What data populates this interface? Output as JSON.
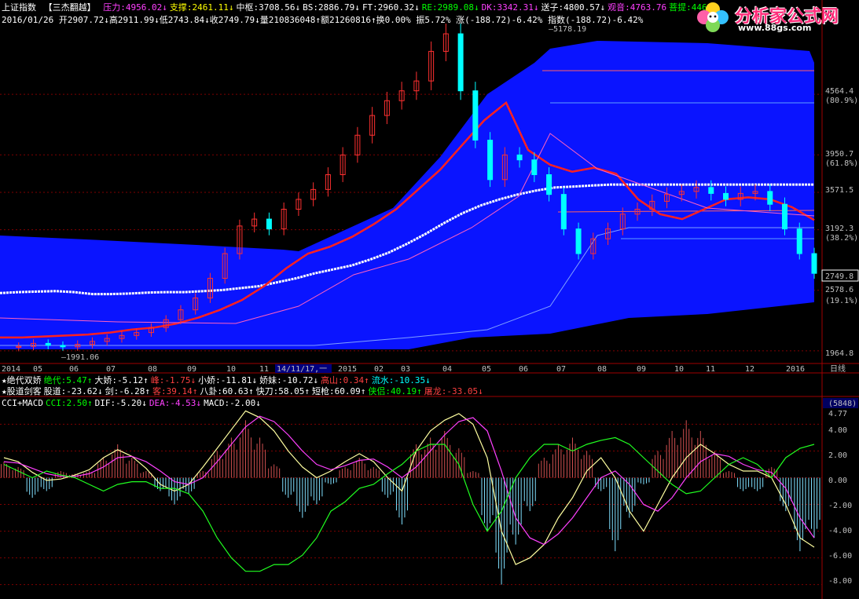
{
  "header": {
    "index_name": "上证指数",
    "formula_name": "【三杰翻越】",
    "indicators_row1": [
      {
        "label": "压力:4956.02↓",
        "color": "#ff40ff"
      },
      {
        "label": "支撑:2461.11↓",
        "color": "#ffff00"
      },
      {
        "label": "中枢:3708.56↓",
        "color": "#ffffff"
      },
      {
        "label": "BS:2886.79↓",
        "color": "#ffffff"
      },
      {
        "label": "FT:2960.32↓",
        "color": "#ffffff"
      },
      {
        "label": "RE:2989.08↓",
        "color": "#00ff00"
      },
      {
        "label": "DK:3342.31↓",
        "color": "#ff40ff"
      },
      {
        "label": "送子:4800.57↓",
        "color": "#ffffff"
      },
      {
        "label": "观音:4763.76",
        "color": "#ff40ff"
      },
      {
        "label": "菩提:4465",
        "color": "#00ff00"
      }
    ],
    "quote_row": "2016/01/26 开2907.72↓高2911.99↓低2743.84↓收2749.79↓量210836048↑额21260816↑换0.00% 振5.72% 涨(-188.72)-6.42% 指数(-188.72)-6.42%",
    "row3": [
      {
        "label": "★绝代双娇",
        "color": "#ffffff"
      },
      {
        "label": "绝代:5.47↑",
        "color": "#00ff00"
      },
      {
        "label": "大娇:-5.12↑",
        "color": "#ffffff"
      },
      {
        "label": "峰:-1.75↓",
        "color": "#ff4040"
      },
      {
        "label": "小娇:-11.81↓",
        "color": "#ffffff"
      },
      {
        "label": "娇妹:-10.72↓",
        "color": "#ffffff"
      },
      {
        "label": "高山:0.34↑",
        "color": "#ff4040"
      },
      {
        "label": "流水:-10.35↓",
        "color": "#00ffff"
      }
    ],
    "row4": [
      {
        "label": "★股道剑客",
        "color": "#ffffff"
      },
      {
        "label": "股道:-23.62↓",
        "color": "#ffffff"
      },
      {
        "label": "剑:-6.28↑",
        "color": "#ffffff"
      },
      {
        "label": "客:39.14↑",
        "color": "#ff4040"
      },
      {
        "label": "八卦:60.63↑",
        "color": "#ffffff"
      },
      {
        "label": "快刀:58.05↑",
        "color": "#ffffff"
      },
      {
        "label": "短枪:60.09↑",
        "color": "#ffffff"
      },
      {
        "label": "侠侣:40.19↑",
        "color": "#00ff00"
      },
      {
        "label": "屠龙:-33.05↓",
        "color": "#ff4040"
      }
    ],
    "row5": [
      {
        "label": "CCI+MACD",
        "color": "#ffffff"
      },
      {
        "label": "CCI:2.50↑",
        "color": "#00ff00"
      },
      {
        "label": "DIF:-5.20↓",
        "color": "#ffffff"
      },
      {
        "label": "DEA:-4.53↓",
        "color": "#ff40ff"
      },
      {
        "label": "MACD:-2.00↓",
        "color": "#ffffff"
      }
    ]
  },
  "watermark": {
    "title": "分析家公式网",
    "url": "www.88gs.com"
  },
  "colors": {
    "band": "#0a14ff",
    "up": "#ff3030",
    "down": "#00ffff",
    "ma_red": "#ff2020",
    "ma_white": "#ffffff",
    "grid": "#800000"
  },
  "chart_data": [
    {
      "type": "candlestick",
      "title": "上证指数",
      "y_ticks": [
        "4564.4",
        "(80.9%)",
        "3950.7",
        "(61.8%)",
        "3571.5",
        "3192.3",
        "(38.2%)",
        "2578.6",
        "(19.1%)",
        "1964.8"
      ],
      "y_tick_values": [
        4564.4,
        null,
        3950.7,
        null,
        3571.5,
        3192.3,
        null,
        2578.6,
        null,
        1964.8
      ],
      "last_price": "2749.8",
      "annotations": [
        "5178.19",
        "1991.06"
      ],
      "x_ticks": [
        "2014",
        "05",
        "06",
        "07",
        "08",
        "09",
        "10",
        "11",
        "14/11/17,一",
        "2015",
        "02",
        "03",
        "04",
        "05",
        "06",
        "07",
        "08",
        "09",
        "10",
        "11",
        "12",
        "2016"
      ],
      "period": "日线",
      "price_series": [
        2000,
        2010,
        2040,
        2020,
        2005,
        2030,
        2060,
        2090,
        2120,
        2150,
        2200,
        2280,
        2380,
        2500,
        2700,
        2950,
        3230,
        3300,
        3200,
        3400,
        3500,
        3600,
        3750,
        3950,
        4150,
        4350,
        4500,
        4600,
        4700,
        5000,
        5178,
        4600,
        4100,
        3700,
        3950,
        3900,
        3750,
        3550,
        3200,
        2950,
        3100,
        3200,
        3350,
        3400,
        3480,
        3550,
        3580,
        3620,
        3560,
        3500,
        3560,
        3580,
        3450,
        3200,
        2950,
        2750
      ],
      "white_ma": [
        2550,
        2560,
        2565,
        2570,
        2560,
        2540,
        2540,
        2545,
        2555,
        2560,
        2560,
        2570,
        2580,
        2600,
        2620,
        2660,
        2700,
        2750,
        2790,
        2830,
        2890,
        2960,
        3050,
        3150,
        3260,
        3360,
        3440,
        3500,
        3550,
        3590,
        3620,
        3630,
        3640,
        3650,
        3650,
        3650,
        3650,
        3650,
        3650,
        3650,
        3650,
        3650,
        3650,
        3650,
        3650
      ],
      "red_ma": [
        2100,
        2100,
        2110,
        2120,
        2130,
        2150,
        2180,
        2200,
        2240,
        2300,
        2380,
        2480,
        2620,
        2800,
        2950,
        3020,
        3120,
        3250,
        3400,
        3600,
        3800,
        4050,
        4300,
        4480,
        4000,
        3850,
        3780,
        3820,
        3760,
        3500,
        3350,
        3300,
        3400,
        3500,
        3520,
        3500,
        3420,
        3290
      ]
    },
    {
      "type": "bar",
      "title": "CCI+MACD",
      "ylim": [
        -8,
        4.77
      ],
      "y_ticks": [
        "(5848)",
        "4.77",
        "4.00",
        "2.00",
        "0.00",
        "-2.00",
        "-4.00",
        "-6.00",
        "-8.00"
      ],
      "y_tick_values": [
        null,
        4.77,
        4,
        2,
        0,
        -2,
        -4,
        -6,
        -8
      ],
      "series": [
        {
          "name": "MACD",
          "values": [
            1.2,
            0.8,
            -1.5,
            -1.0,
            0.5,
            0.3,
            0.5,
            1.5,
            2.5,
            1.5,
            0.5,
            -1.0,
            -2.0,
            -1.2,
            0.5,
            2.0,
            3.0,
            4.3,
            3.0,
            1.0,
            -1.5,
            -3.0,
            -2.0,
            -0.5,
            0.8,
            1.5,
            0.8,
            -1.5,
            -3.5,
            2.5,
            3.0,
            3.5,
            2.2,
            0.5,
            -4.0,
            -8.0,
            -5.0,
            -2.5,
            1.5,
            2.5,
            3.0,
            2.0,
            -1.0,
            -5.5,
            -3.0,
            -0.5,
            2.0,
            3.5,
            4.3,
            3.5,
            2.0,
            0.5,
            -1.0,
            -1.0,
            0.8,
            -2.5,
            -5.5,
            -4.5
          ]
        },
        {
          "name": "DIF",
          "values": [
            1.5,
            1.2,
            0.4,
            -0.2,
            -0.1,
            0.2,
            0.6,
            1.5,
            2.1,
            1.6,
            0.7,
            -0.5,
            -1.0,
            -0.5,
            0.8,
            2.2,
            3.6,
            5.0,
            4.5,
            3.5,
            2.0,
            0.8,
            0.0,
            0.5,
            1.2,
            1.8,
            1.2,
            0.0,
            -1.0,
            2.0,
            3.5,
            4.3,
            4.8,
            4.0,
            1.5,
            -4.0,
            -6.5,
            -6.0,
            -5.0,
            -3.0,
            -1.5,
            0.5,
            1.5,
            0.0,
            -2.5,
            -4.0,
            -2.0,
            0.0,
            1.5,
            2.5,
            1.8,
            1.0,
            0.5,
            0.5,
            0.0,
            -2.0,
            -4.5,
            -5.2
          ]
        },
        {
          "name": "DEA",
          "values": [
            1.2,
            1.1,
            0.7,
            0.3,
            0.1,
            0.1,
            0.3,
            0.8,
            1.5,
            1.6,
            1.2,
            0.5,
            -0.3,
            -0.5,
            0.0,
            1.2,
            2.5,
            3.8,
            4.6,
            4.2,
            3.2,
            2.0,
            1.0,
            0.6,
            0.9,
            1.3,
            1.4,
            0.8,
            0.0,
            0.8,
            2.0,
            3.2,
            4.2,
            4.5,
            3.5,
            0.5,
            -3.0,
            -4.5,
            -5.0,
            -4.2,
            -3.0,
            -1.5,
            0.0,
            0.5,
            -0.5,
            -2.0,
            -2.5,
            -1.5,
            0.0,
            1.2,
            1.8,
            1.6,
            1.0,
            0.6,
            0.4,
            -0.8,
            -3.0,
            -4.5
          ]
        },
        {
          "name": "CCI",
          "values": [
            1.0,
            0.5,
            0.0,
            0.5,
            0.2,
            0.0,
            -0.5,
            -1.0,
            -0.5,
            -0.3,
            -0.3,
            -0.8,
            -0.8,
            -1.2,
            -2.5,
            -4.5,
            -6.0,
            -7.0,
            -7.0,
            -6.5,
            -6.5,
            -5.8,
            -4.5,
            -2.5,
            -1.8,
            -0.8,
            -0.5,
            0.3,
            1.0,
            2.0,
            2.5,
            2.5,
            1.0,
            -2.0,
            -4.0,
            -2.5,
            0.0,
            1.5,
            2.5,
            2.5,
            2.0,
            2.5,
            2.8,
            3.0,
            2.5,
            1.5,
            0.5,
            -0.5,
            -1.2,
            -1.0,
            0.0,
            1.0,
            1.5,
            1.0,
            0.0,
            1.5,
            2.2,
            2.5
          ]
        }
      ]
    }
  ]
}
